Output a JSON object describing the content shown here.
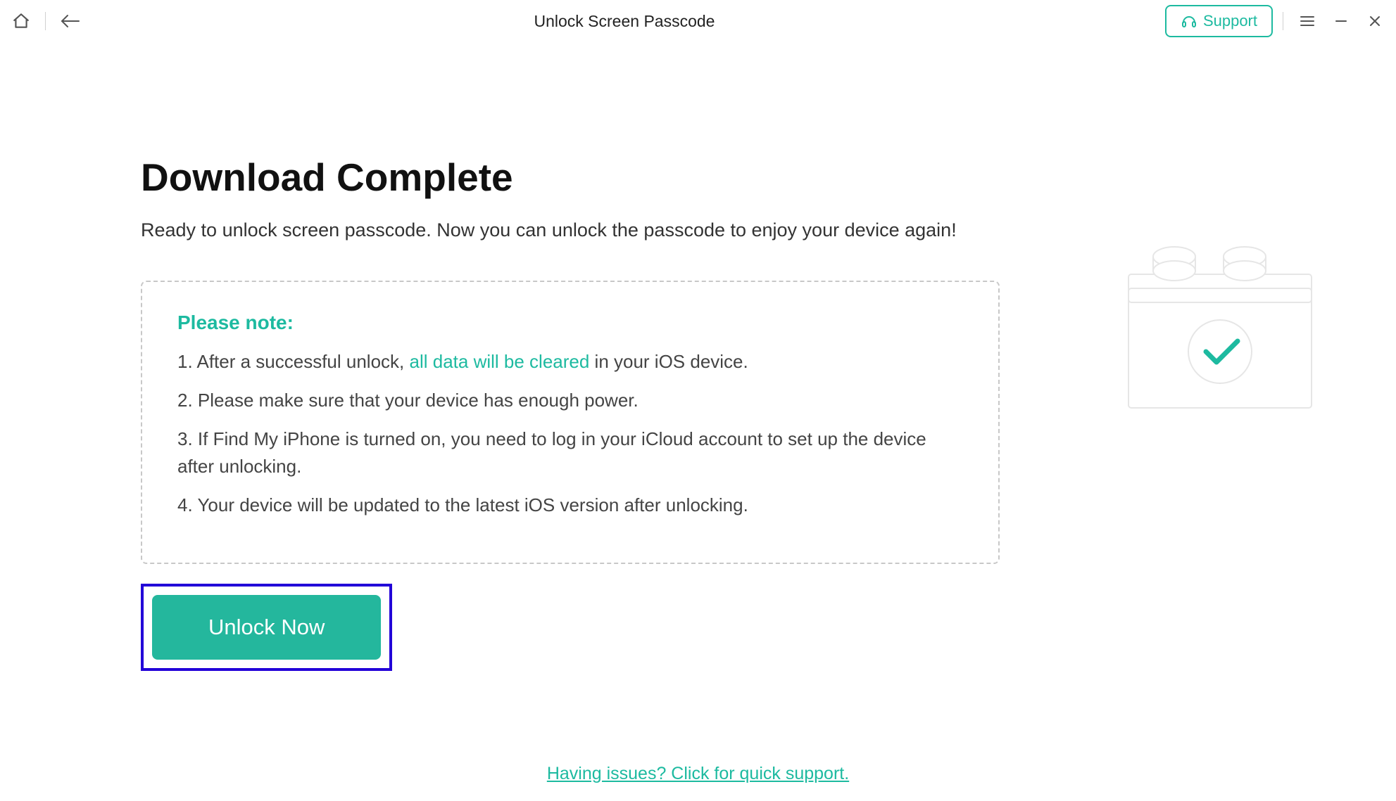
{
  "titlebar": {
    "title": "Unlock Screen Passcode",
    "support_label": "Support"
  },
  "main": {
    "heading": "Download Complete",
    "subheading": "Ready to unlock screen passcode. Now you can unlock the passcode to enjoy your device again!"
  },
  "note": {
    "title": "Please note:",
    "item1_prefix": "1. After a successful unlock, ",
    "item1_highlight": "all data will be cleared",
    "item1_suffix": " in your iOS device.",
    "item2": "2. Please make sure that your device has enough power.",
    "item3": "3. If Find My iPhone is turned on, you need to log in your iCloud account to set up the device after unlocking.",
    "item4": "4. Your device will be updated to the latest iOS version after unlocking."
  },
  "actions": {
    "unlock_label": "Unlock Now"
  },
  "footer": {
    "support_link": "Having issues? Click for quick support."
  },
  "colors": {
    "accent": "#1dbaa0",
    "highlight_border": "#2200d8"
  }
}
